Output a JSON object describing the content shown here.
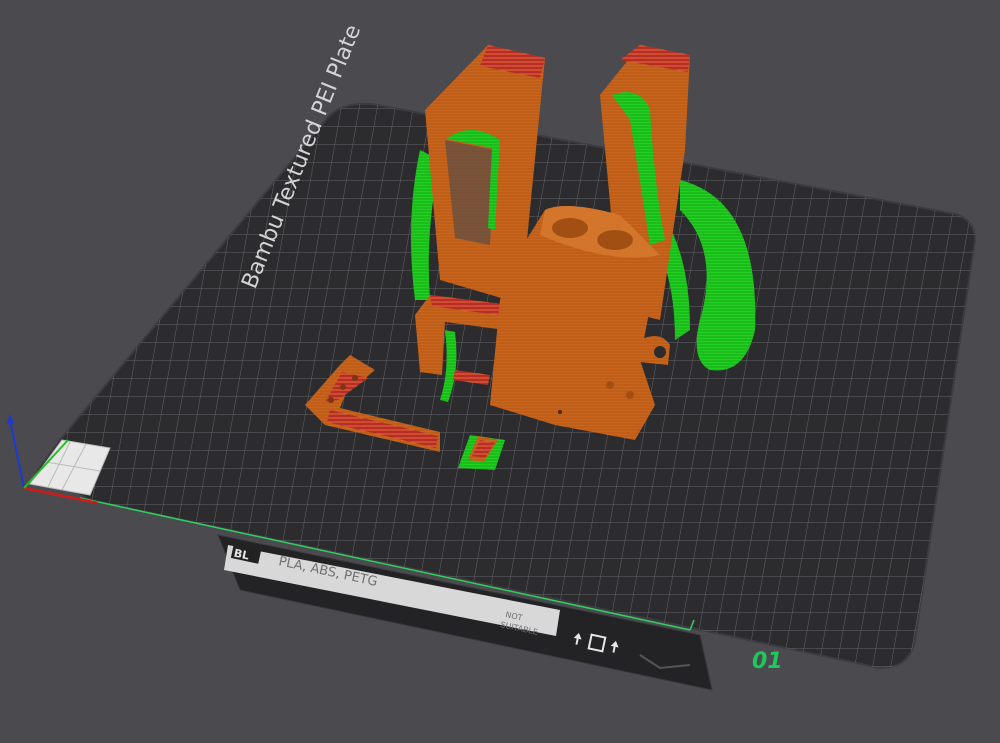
{
  "viewport": {
    "plate_name": "Bambu Textured PEI Plate",
    "plate_number": "01",
    "label_area": {
      "logo_text": "BL",
      "materials": "PLA, ABS, PETG",
      "not_suitable_line1": "NOT",
      "not_suitable_line2": "SUITABLE"
    }
  },
  "colors": {
    "background": "#4a4a4f",
    "plate": "#2c2c2f",
    "grid": "#6a6a6e",
    "model_orange": "#c9651c",
    "model_red": "#b62d26",
    "support_green": "#1fcf1f",
    "plate_number_green": "#1ec85a",
    "axis_x": "#d01a1a",
    "axis_y": "#20c020",
    "axis_z": "#1a3ad6"
  },
  "icons": [
    "axis-gizmo-icon",
    "recycle-up-icon",
    "square-icon"
  ]
}
